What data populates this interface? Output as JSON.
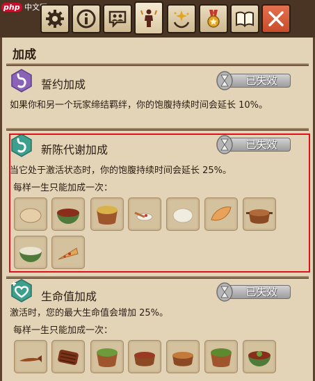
{
  "watermark": {
    "brand": "php",
    "text": "中文网"
  },
  "tabs": [
    {
      "name": "settings",
      "icon": "gear-icon"
    },
    {
      "name": "info",
      "icon": "info-icon"
    },
    {
      "name": "social",
      "icon": "group-chat-icon"
    },
    {
      "name": "character",
      "icon": "character-icon",
      "active": true
    },
    {
      "name": "perks",
      "icon": "sparkle-hands-icon"
    },
    {
      "name": "achievements",
      "icon": "medal-icon"
    },
    {
      "name": "journal",
      "icon": "book-icon"
    },
    {
      "name": "close",
      "icon": "close-icon"
    }
  ],
  "panel": {
    "heading": "加成",
    "bonuses": [
      {
        "title": "誓约加成",
        "status": "已失效",
        "description": "如果你和另一个玩家缔结羁绊，你的饱腹持续时间会延长 10%。",
        "badge_color": "#8a63b8"
      },
      {
        "title": "新陈代谢加成",
        "status": "已失效",
        "description": "当它处于激活状态时，你的饱腹持续时间会延长 25%。",
        "subheading": "每样一生只能加成一次：",
        "badge_color": "#3d9f8e",
        "foods": [
          "bread-icon",
          "bean-soup-bowl-icon",
          "fried-rice-pot-icon",
          "rice-spoon-icon",
          "rice-ball-icon",
          "roast-chicken-icon",
          "stew-pot-icon",
          "porridge-bowl-icon",
          "pizza-slice-icon"
        ]
      },
      {
        "title": "生命值加成",
        "status": "已失效",
        "description": "激活时，您的最大生命值会增加 25%。",
        "subheading": "每样一生只能加成一次：",
        "badge_color": "#3d9f8e",
        "foods": [
          "dried-fish-icon",
          "grilled-meat-icon",
          "veggie-bowl-icon",
          "meat-stew-pot-icon",
          "bean-pot-icon",
          "green-soup-pot-icon",
          "salad-bowl-icon"
        ]
      }
    ]
  },
  "colors": {
    "highlight": "#e0101a",
    "panel_bg": "#e3d4b7",
    "frame": "#4a3423"
  }
}
